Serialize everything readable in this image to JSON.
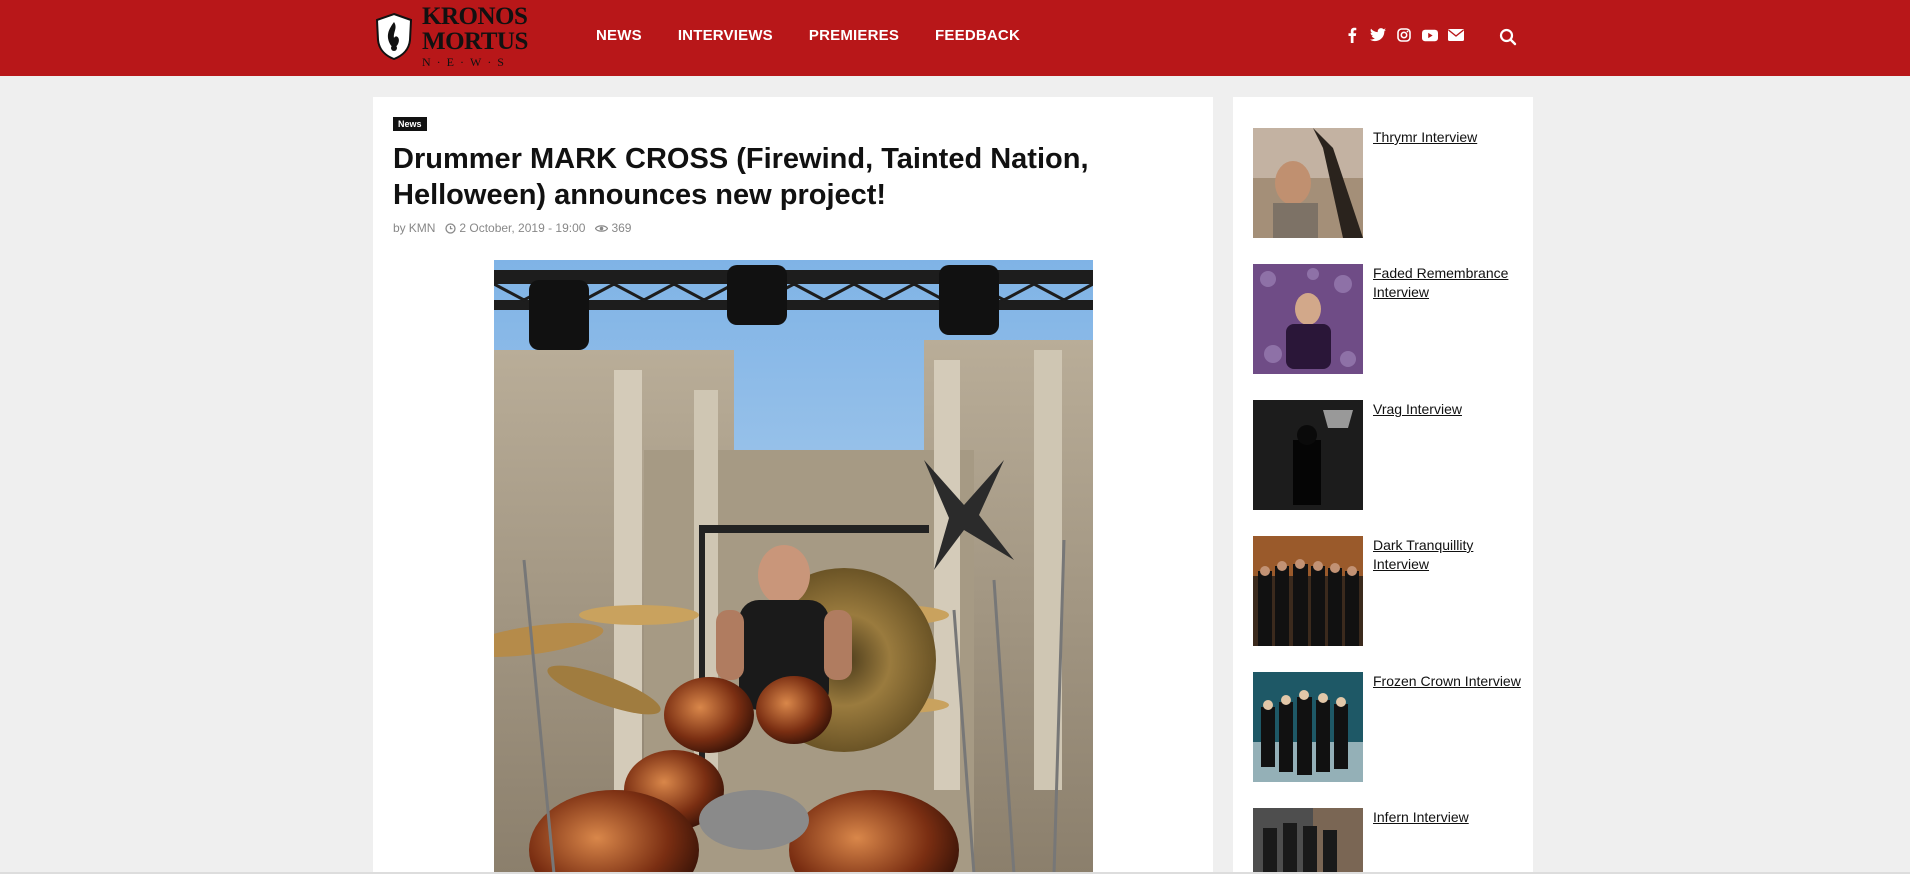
{
  "site": {
    "logo": {
      "line1": "KRONOS",
      "line2": "MORTUS",
      "line3": "N·E·W·S"
    }
  },
  "nav": {
    "items": [
      {
        "label": "NEWS"
      },
      {
        "label": "INTERVIEWS"
      },
      {
        "label": "PREMIERES"
      },
      {
        "label": "FEEDBACK"
      }
    ]
  },
  "social": {
    "icons": [
      "facebook-icon",
      "twitter-icon",
      "instagram-icon",
      "youtube-icon",
      "envelope-icon"
    ]
  },
  "article": {
    "category": "News",
    "title": "Drummer MARK CROSS (Firewind, Tainted Nation, Helloween) announces new project!",
    "author_prefix": "by",
    "author": "KMN",
    "date": "2 October, 2019 - 19:00",
    "views": "369"
  },
  "sidebar": {
    "items": [
      {
        "title": "Thrymr Interview"
      },
      {
        "title": "Faded Remembrance Interview"
      },
      {
        "title": "Vrag Interview"
      },
      {
        "title": "Dark Tranquillity Interview"
      },
      {
        "title": "Frozen Crown Interview"
      },
      {
        "title": "Infern Interview"
      }
    ]
  },
  "colors": {
    "brand": "#b81719",
    "badge": "#111111",
    "meta": "#888888"
  }
}
